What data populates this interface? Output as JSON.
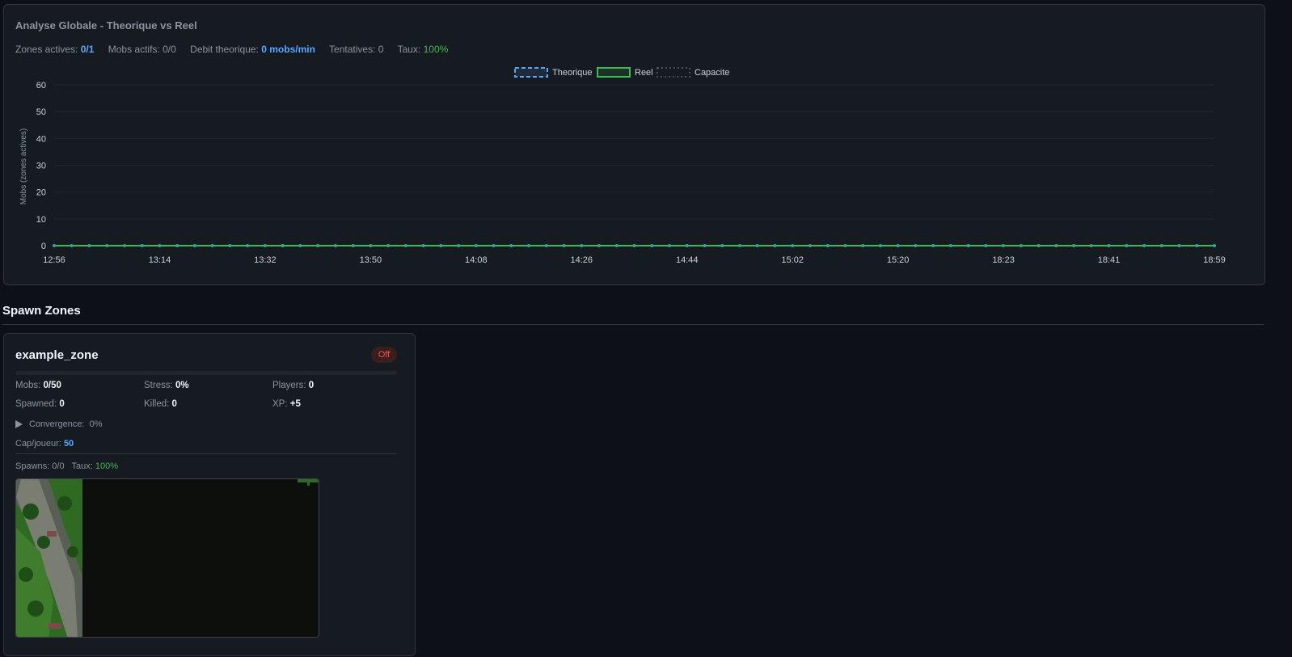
{
  "analysis": {
    "title": "Analyse Globale - Theorique vs Reel",
    "stats": {
      "zones_label": "Zones actives:",
      "zones_value": "0/1",
      "mobs_label": "Mobs actifs:",
      "mobs_value": "0/0",
      "debit_label": "Debit theorique:",
      "debit_value": "0 mobs/min",
      "tentatives_label": "Tentatives:",
      "tentatives_value": "0",
      "taux_label": "Taux:",
      "taux_value": "100%"
    }
  },
  "chart_data": {
    "type": "line",
    "title": "",
    "ylabel": "Mobs (zones actives)",
    "xlabel": "",
    "ylim": [
      0,
      60
    ],
    "yticks": [
      0,
      10,
      20,
      30,
      40,
      50,
      60
    ],
    "xticks": [
      "12:56",
      "13:14",
      "13:32",
      "13:50",
      "14:08",
      "14:26",
      "14:44",
      "15:02",
      "15:20",
      "18:23",
      "18:41",
      "18:59"
    ],
    "legend_position": "top-center",
    "point_count": 67,
    "series": [
      {
        "name": "Theorique",
        "style": "dashed",
        "color": "#58a6ff",
        "value": 0
      },
      {
        "name": "Reel",
        "style": "solid",
        "color": "#3fb950",
        "value": 0
      },
      {
        "name": "Capacite",
        "style": "dotted",
        "color": "#484f58",
        "value": 0
      }
    ]
  },
  "spawn_zones": {
    "section_title": "Spawn Zones",
    "zones": [
      {
        "name": "example_zone",
        "status": "Off",
        "fill_fraction": 0,
        "mobs_label": "Mobs:",
        "mobs_value": "0/50",
        "stress_label": "Stress:",
        "stress_value": "0%",
        "players_label": "Players:",
        "players_value": "0",
        "spawned_label": "Spawned:",
        "spawned_value": "0",
        "killed_label": "Killed:",
        "killed_value": "0",
        "xp_label": "XP:",
        "xp_value": "+5",
        "convergence_label": "Convergence:",
        "convergence_value": "0%",
        "cap_label": "Cap/joueur:",
        "cap_value": "50",
        "spawns_label": "Spawns:",
        "spawns_value": "0/0",
        "taux_label": "Taux:",
        "taux_value": "100%"
      }
    ]
  },
  "colors": {
    "background": "#0d1117",
    "panel": "#161b22",
    "accent_blue": "#58a6ff",
    "accent_green": "#3fb950",
    "status_off": "#f85149"
  }
}
